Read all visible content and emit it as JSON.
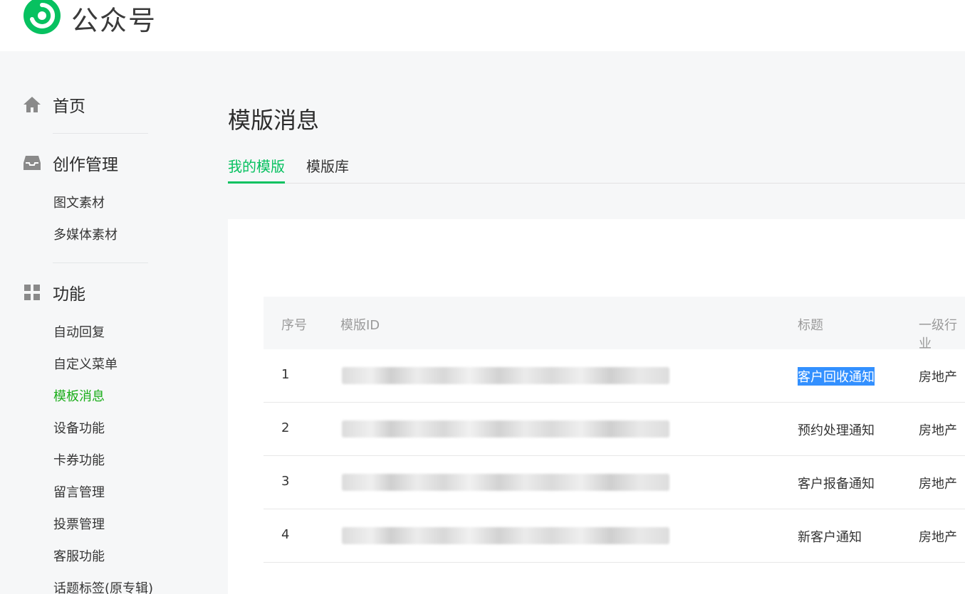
{
  "app": {
    "title": "公众号"
  },
  "sidebar": {
    "groups": [
      {
        "label": "首页",
        "icon": "home-icon",
        "items": []
      },
      {
        "label": "创作管理",
        "icon": "inbox-icon",
        "items": [
          "图文素材",
          "多媒体素材"
        ]
      },
      {
        "label": "功能",
        "icon": "grid-icon",
        "items": [
          "自动回复",
          "自定义菜单",
          "模板消息",
          "设备功能",
          "卡券功能",
          "留言管理",
          "投票管理",
          "客服功能",
          "话题标签(原专辑)"
        ]
      }
    ],
    "active_item": "模板消息"
  },
  "main": {
    "title": "模版消息",
    "tabs": [
      {
        "label": "我的模版",
        "active": true
      },
      {
        "label": "模版库",
        "active": false
      }
    ],
    "table": {
      "columns": [
        "序号",
        "模版ID",
        "标题",
        "一级行业"
      ],
      "rows": [
        {
          "index": "1",
          "title": "客户回收通知",
          "industry": "房地产",
          "selected": true
        },
        {
          "index": "2",
          "title": "预约处理通知",
          "industry": "房地产",
          "selected": false
        },
        {
          "index": "3",
          "title": "客户报备通知",
          "industry": "房地产",
          "selected": false
        },
        {
          "index": "4",
          "title": "新客户通知",
          "industry": "房地产",
          "selected": false
        }
      ]
    }
  },
  "colors": {
    "accent": "#07c160",
    "active_nav": "#1aad19",
    "selection": "#3390ff"
  }
}
